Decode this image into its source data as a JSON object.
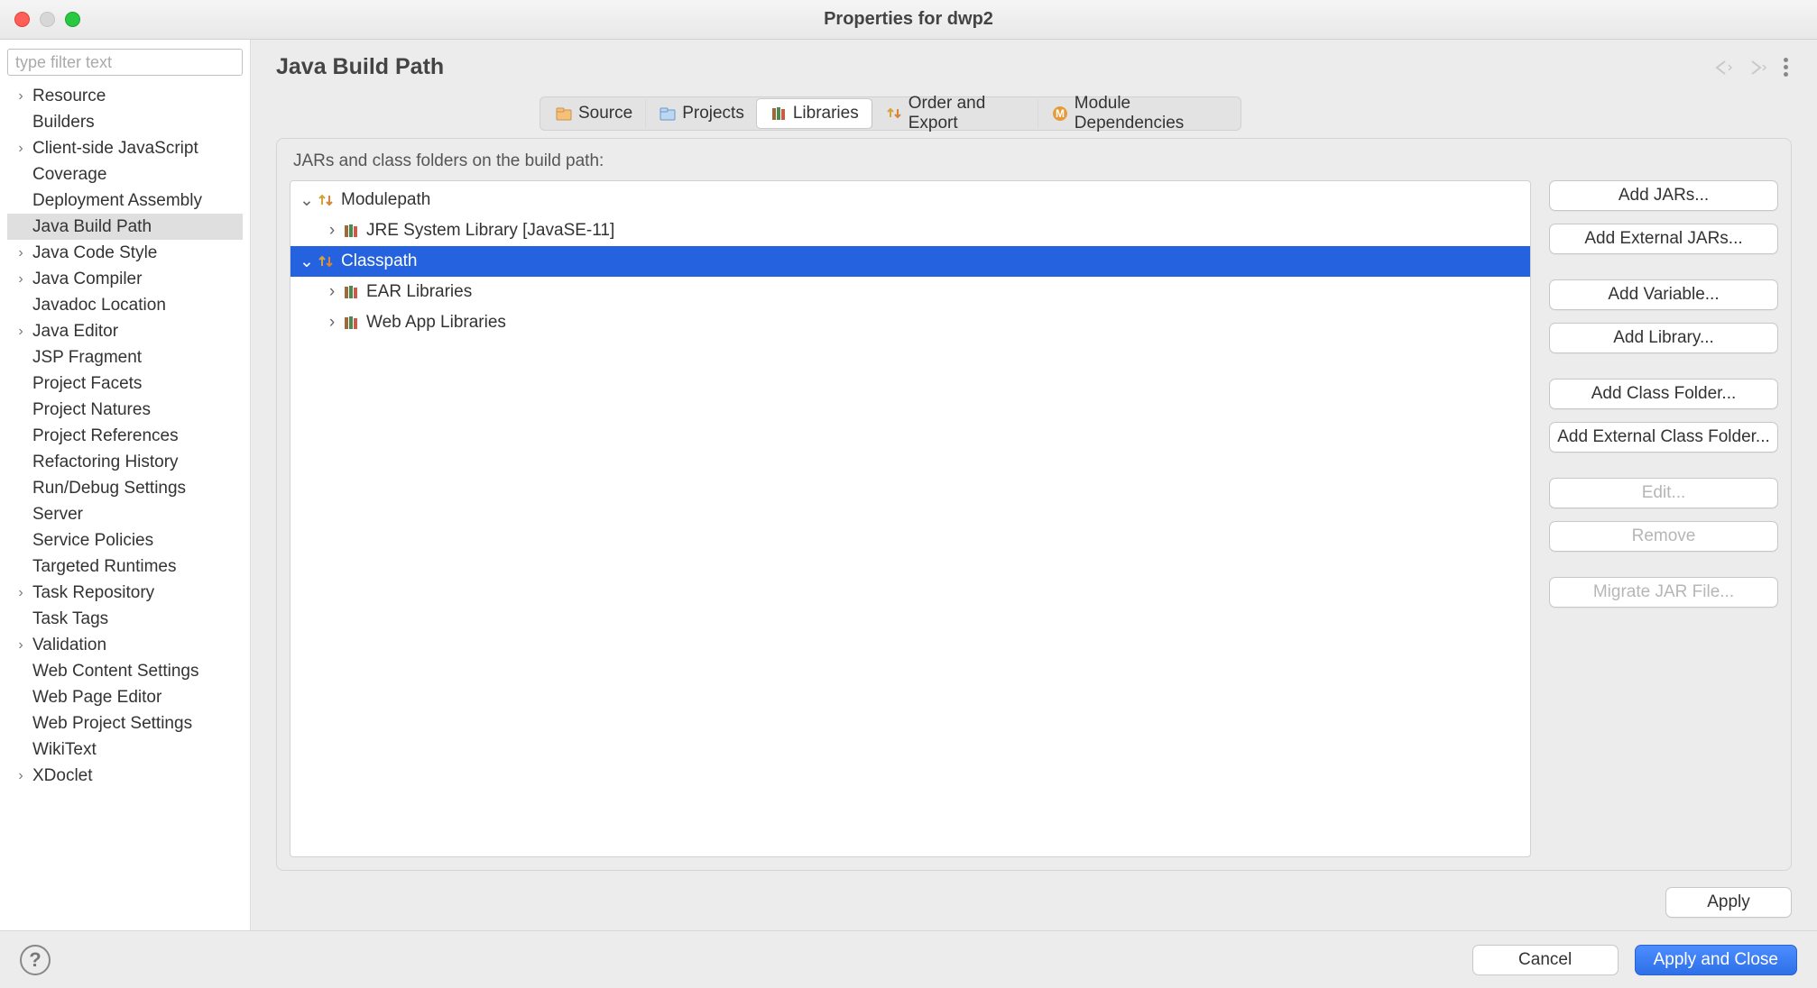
{
  "window": {
    "title": "Properties for dwp2"
  },
  "sidebar": {
    "filter_placeholder": "type filter text",
    "items": [
      {
        "label": "Resource",
        "expandable": true
      },
      {
        "label": "Builders",
        "expandable": false
      },
      {
        "label": "Client-side JavaScript",
        "expandable": true
      },
      {
        "label": "Coverage",
        "expandable": false
      },
      {
        "label": "Deployment Assembly",
        "expandable": false
      },
      {
        "label": "Java Build Path",
        "expandable": false,
        "selected": true
      },
      {
        "label": "Java Code Style",
        "expandable": true
      },
      {
        "label": "Java Compiler",
        "expandable": true
      },
      {
        "label": "Javadoc Location",
        "expandable": false
      },
      {
        "label": "Java Editor",
        "expandable": true
      },
      {
        "label": "JSP Fragment",
        "expandable": false
      },
      {
        "label": "Project Facets",
        "expandable": false
      },
      {
        "label": "Project Natures",
        "expandable": false
      },
      {
        "label": "Project References",
        "expandable": false
      },
      {
        "label": "Refactoring History",
        "expandable": false
      },
      {
        "label": "Run/Debug Settings",
        "expandable": false
      },
      {
        "label": "Server",
        "expandable": false
      },
      {
        "label": "Service Policies",
        "expandable": false
      },
      {
        "label": "Targeted Runtimes",
        "expandable": false
      },
      {
        "label": "Task Repository",
        "expandable": true
      },
      {
        "label": "Task Tags",
        "expandable": false
      },
      {
        "label": "Validation",
        "expandable": true
      },
      {
        "label": "Web Content Settings",
        "expandable": false
      },
      {
        "label": "Web Page Editor",
        "expandable": false
      },
      {
        "label": "Web Project Settings",
        "expandable": false
      },
      {
        "label": "WikiText",
        "expandable": false
      },
      {
        "label": "XDoclet",
        "expandable": true
      }
    ]
  },
  "page": {
    "title": "Java Build Path",
    "tabs": [
      {
        "label": "Source",
        "icon": "folder-source"
      },
      {
        "label": "Projects",
        "icon": "folder-projects"
      },
      {
        "label": "Libraries",
        "icon": "library",
        "active": true
      },
      {
        "label": "Order and Export",
        "icon": "order"
      },
      {
        "label": "Module Dependencies",
        "icon": "module"
      }
    ],
    "desc": "JARs and class folders on the build path:",
    "tree": [
      {
        "label": "Modulepath",
        "icon": "module-path",
        "expanded": true,
        "depth": 0
      },
      {
        "label": "JRE System Library [JavaSE-11]",
        "icon": "library",
        "expanded": false,
        "depth": 1,
        "parent": true
      },
      {
        "label": "Classpath",
        "icon": "module-path",
        "expanded": true,
        "depth": 0,
        "selected": true
      },
      {
        "label": "EAR Libraries",
        "icon": "library",
        "expanded": false,
        "depth": 1,
        "parent": true
      },
      {
        "label": "Web App Libraries",
        "icon": "library",
        "expanded": false,
        "depth": 1,
        "parent": true
      }
    ],
    "buttons": [
      {
        "label": "Add JARs..."
      },
      {
        "label": "Add External JARs..."
      },
      {
        "label": "Add Variable...",
        "gap": true
      },
      {
        "label": "Add Library..."
      },
      {
        "label": "Add Class Folder...",
        "gap": true
      },
      {
        "label": "Add External Class Folder..."
      },
      {
        "label": "Edit...",
        "disabled": true,
        "gap": true
      },
      {
        "label": "Remove",
        "disabled": true
      },
      {
        "label": "Migrate JAR File...",
        "disabled": true,
        "gap": true
      }
    ],
    "apply": "Apply"
  },
  "footer": {
    "cancel": "Cancel",
    "apply_close": "Apply and Close"
  }
}
